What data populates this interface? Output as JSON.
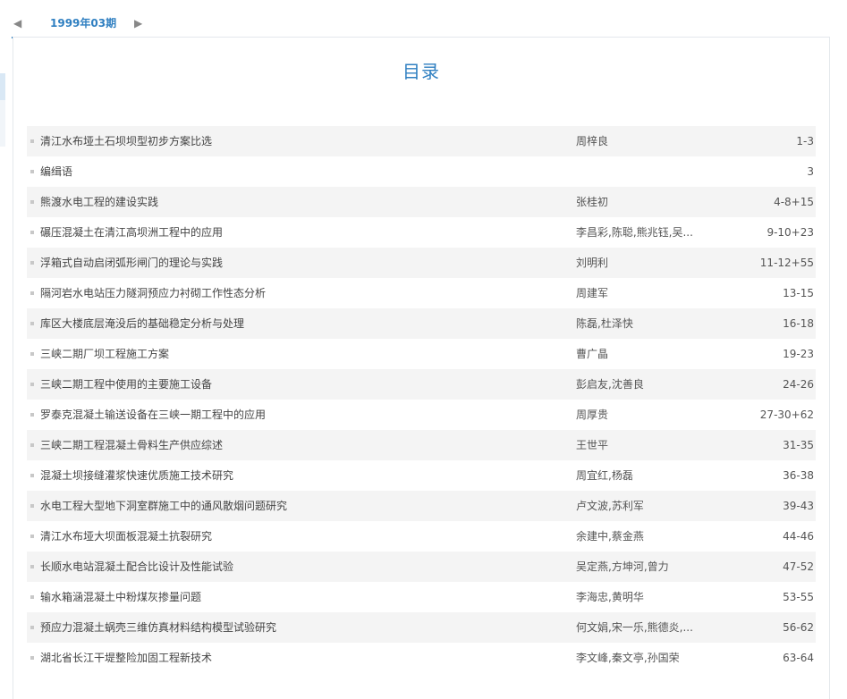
{
  "issue_nav": {
    "prev_icon": "left-triangle-icon",
    "next_icon": "right-triangle-icon",
    "issue_label": "1999年03期"
  },
  "toc": {
    "title": "目录",
    "items": [
      {
        "title": "清江水布垭土石坝坝型初步方案比选",
        "authors": "周梓良",
        "pages": "1-3"
      },
      {
        "title": "编缉语",
        "authors": "",
        "pages": "3"
      },
      {
        "title": "熊渡水电工程的建设实践",
        "authors": "张桂初",
        "pages": "4-8+15"
      },
      {
        "title": "碾压混凝土在清江高坝洲工程中的应用",
        "authors": "李昌彩,陈聪,熊兆钰,吴...",
        "pages": "9-10+23"
      },
      {
        "title": "浮箱式自动启闭弧形闸门的理论与实践",
        "authors": "刘明利",
        "pages": "11-12+55"
      },
      {
        "title": "隔河岩水电站压力隧洞预应力衬砌工作性态分析",
        "authors": "周建军",
        "pages": "13-15"
      },
      {
        "title": "库区大楼底层淹没后的基础稳定分析与处理",
        "authors": "陈磊,杜泽快",
        "pages": "16-18"
      },
      {
        "title": "三峡二期厂坝工程施工方案",
        "authors": "曹广晶",
        "pages": "19-23"
      },
      {
        "title": "三峡二期工程中使用的主要施工设备",
        "authors": "彭启友,沈善良",
        "pages": "24-26"
      },
      {
        "title": "罗泰克混凝土输送设备在三峡一期工程中的应用",
        "authors": "周厚贵",
        "pages": "27-30+62"
      },
      {
        "title": "三峡二期工程混凝土骨料生产供应综述",
        "authors": "王世平",
        "pages": "31-35"
      },
      {
        "title": "混凝土坝接缝灌浆快速优质施工技术研究",
        "authors": "周宜红,杨磊",
        "pages": "36-38"
      },
      {
        "title": "水电工程大型地下洞室群施工中的通风散烟问题研究",
        "authors": "卢文波,苏利军",
        "pages": "39-43"
      },
      {
        "title": "清江水布垭大坝面板混凝土抗裂研究",
        "authors": "余建中,蔡金燕",
        "pages": "44-46"
      },
      {
        "title": "长顺水电站混凝土配合比设计及性能试验",
        "authors": "吴定燕,方坤河,曾力",
        "pages": "47-52"
      },
      {
        "title": "输水箱涵混凝土中粉煤灰掺量问题",
        "authors": "李海忠,黄明华",
        "pages": "53-55"
      },
      {
        "title": "预应力混凝土蜗壳三维仿真材料结构模型试验研究",
        "authors": "何文娟,宋一乐,熊德炎,...",
        "pages": "56-62"
      },
      {
        "title": "湖北省长江干堤整险加固工程新技术",
        "authors": "李文峰,秦文亭,孙国荣",
        "pages": "63-64"
      }
    ]
  },
  "colors": {
    "accent": "#2f7fc1",
    "row_stripe": "#f4f4f4",
    "text": "#444444"
  }
}
